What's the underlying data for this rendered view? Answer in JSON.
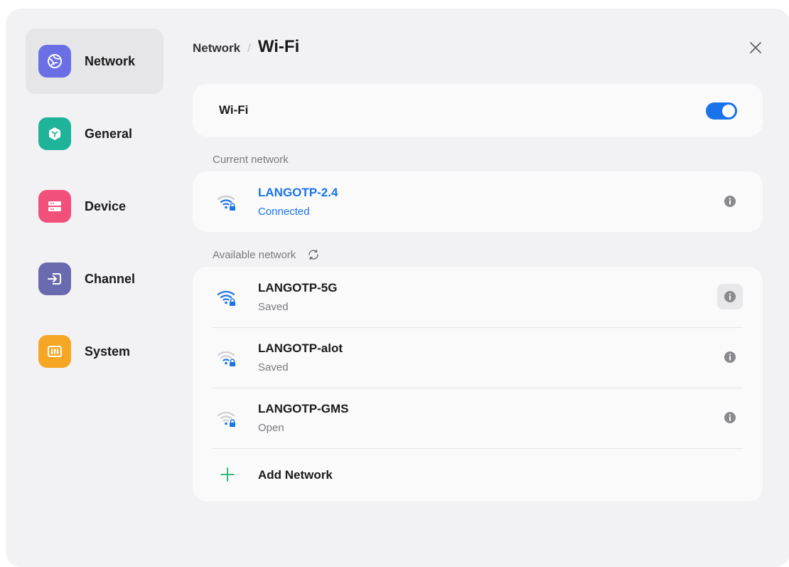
{
  "sidebar": {
    "items": [
      {
        "label": "Network",
        "icon": "globe-icon",
        "color": "#6b6fe6",
        "active": true
      },
      {
        "label": "General",
        "icon": "cube-icon",
        "color": "#1fb39a",
        "active": false
      },
      {
        "label": "Device",
        "icon": "server-icon",
        "color": "#f0507a",
        "active": false
      },
      {
        "label": "Channel",
        "icon": "input-icon",
        "color": "#6a6ab0",
        "active": false
      },
      {
        "label": "System",
        "icon": "sliders-icon",
        "color": "#f5a623",
        "active": false
      }
    ]
  },
  "header": {
    "breadcrumb_parent": "Network",
    "breadcrumb_separator": "/",
    "title": "Wi-Fi"
  },
  "wifi_toggle": {
    "label": "Wi-Fi",
    "enabled": true,
    "accent": "#1a73e8"
  },
  "current_network": {
    "section_label": "Current network",
    "name": "LANGOTP-2.4",
    "status": "Connected"
  },
  "available_networks": {
    "section_label": "Available network",
    "items": [
      {
        "name": "LANGOTP-5G",
        "status": "Saved",
        "signal": "full"
      },
      {
        "name": "LANGOTP-alot",
        "status": "Saved",
        "signal": "medium"
      },
      {
        "name": "LANGOTP-GMS",
        "status": "Open",
        "signal": "weak"
      }
    ],
    "add_label": "Add Network"
  }
}
